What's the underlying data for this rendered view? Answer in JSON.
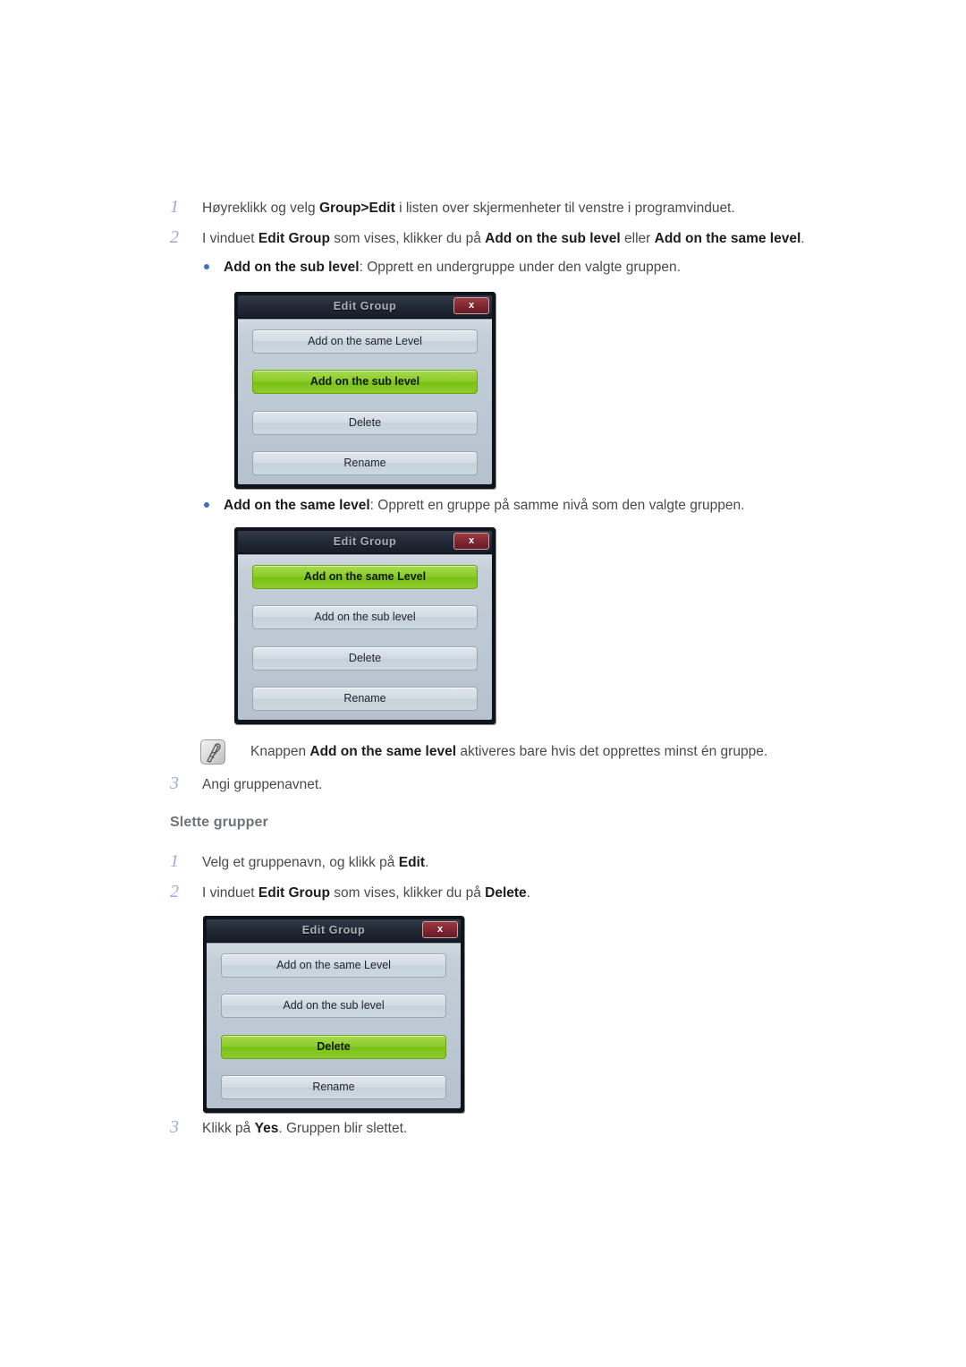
{
  "steps": [
    {
      "num": "1",
      "parts": [
        {
          "t": "Høyreklikk og velg ",
          "b": false
        },
        {
          "t": "Group>Edit",
          "b": true
        },
        {
          "t": " i listen over skjermenheter til venstre i programvinduet.",
          "b": false
        }
      ]
    },
    {
      "num": "2",
      "parts": [
        {
          "t": "I vinduet ",
          "b": false
        },
        {
          "t": "Edit Group",
          "b": true
        },
        {
          "t": " som vises, klikker du på ",
          "b": false
        },
        {
          "t": "Add on the sub level",
          "b": true
        },
        {
          "t": " eller ",
          "b": false
        },
        {
          "t": "Add on the same level",
          "b": true
        },
        {
          "t": ".",
          "b": false
        }
      ]
    },
    {
      "num": "3",
      "parts": [
        {
          "t": "Angi gruppenavnet.",
          "b": false
        }
      ]
    },
    {
      "num": "1",
      "parts": [
        {
          "t": "Velg et gruppenavn, og klikk på ",
          "b": false
        },
        {
          "t": "Edit",
          "b": true
        },
        {
          "t": ".",
          "b": false
        }
      ]
    },
    {
      "num": "2",
      "parts": [
        {
          "t": "I vinduet ",
          "b": false
        },
        {
          "t": "Edit Group",
          "b": true
        },
        {
          "t": " som vises, klikker du på ",
          "b": false
        },
        {
          "t": "Delete",
          "b": true
        },
        {
          "t": ".",
          "b": false
        }
      ]
    },
    {
      "num": "3",
      "parts": [
        {
          "t": "Klikk på ",
          "b": false
        },
        {
          "t": "Yes",
          "b": true
        },
        {
          "t": ". Gruppen blir slettet.",
          "b": false
        }
      ]
    }
  ],
  "bullets": [
    {
      "parts": [
        {
          "t": "Add on the sub level",
          "b": true
        },
        {
          "t": ": Opprett en undergruppe under den valgte gruppen.",
          "b": false
        }
      ]
    },
    {
      "parts": [
        {
          "t": "Add on the same level",
          "b": true
        },
        {
          "t": ": Opprett en gruppe på samme nivå som den valgte gruppen.",
          "b": false
        }
      ]
    }
  ],
  "section_heading": "Slette grupper",
  "note": {
    "icon_name": "note-hand-icon",
    "parts": [
      {
        "t": "Knappen ",
        "b": false
      },
      {
        "t": "Add on the same level",
        "b": true
      },
      {
        "t": " aktiveres bare hvis det opprettes minst én gruppe.",
        "b": false
      }
    ]
  },
  "dialogs": [
    {
      "title": "Edit Group",
      "close_label": "x",
      "buttons": [
        {
          "label": "Add on the same Level",
          "selected": false
        },
        {
          "label": "Add on the sub level",
          "selected": true
        },
        {
          "label": "Delete",
          "selected": false
        },
        {
          "label": "Rename",
          "selected": false
        }
      ]
    },
    {
      "title": "Edit Group",
      "close_label": "x",
      "buttons": [
        {
          "label": "Add on the same Level",
          "selected": true
        },
        {
          "label": "Add on the sub level",
          "selected": false
        },
        {
          "label": "Delete",
          "selected": false
        },
        {
          "label": "Rename",
          "selected": false
        }
      ]
    },
    {
      "title": "Edit Group",
      "close_label": "x",
      "buttons": [
        {
          "label": "Add on the same Level",
          "selected": false
        },
        {
          "label": "Add on the sub level",
          "selected": false
        },
        {
          "label": "Delete",
          "selected": true
        },
        {
          "label": "Rename",
          "selected": false
        }
      ]
    }
  ],
  "colors": {
    "step_number": "#9aa7e4",
    "bullet_dot": "#3c6fc0",
    "heading": "#6f7479",
    "body_text": "#4a4a4a",
    "selected_button": "#8ccb2a",
    "dialog_titlebar": "#232c38",
    "close_button": "#7e2630"
  }
}
